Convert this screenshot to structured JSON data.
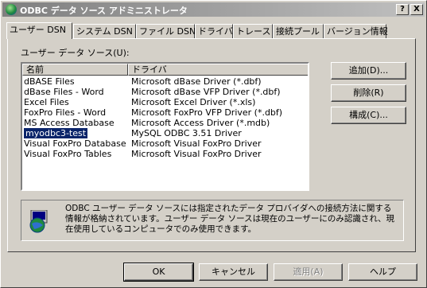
{
  "window": {
    "title": "ODBC データ ソース アドミニストレータ",
    "help_btn": "?",
    "close_btn": "X"
  },
  "tabs": [
    {
      "label": "ユーザー DSN",
      "active": true
    },
    {
      "label": "システム DSN"
    },
    {
      "label": "ファイル DSN"
    },
    {
      "label": "ドライバ"
    },
    {
      "label": "トレース"
    },
    {
      "label": "接続プール"
    },
    {
      "label": "バージョン情報"
    }
  ],
  "user_dsn": {
    "list_label": "ユーザー データ ソース(U):",
    "columns": [
      "名前",
      "ドライバ"
    ],
    "rows": [
      {
        "name": "dBASE Files",
        "driver": "Microsoft dBase Driver (*.dbf)"
      },
      {
        "name": "dBase Files - Word",
        "driver": "Microsoft dBase VFP Driver (*.dbf)"
      },
      {
        "name": "Excel Files",
        "driver": "Microsoft Excel Driver (*.xls)"
      },
      {
        "name": "FoxPro Files - Word",
        "driver": "Microsoft FoxPro VFP Driver (*.dbf)"
      },
      {
        "name": "MS Access Database",
        "driver": "Microsoft Access Driver (*.mdb)"
      },
      {
        "name": "myodbc3-test",
        "driver": "MySQL ODBC 3.51 Driver",
        "selected": true
      },
      {
        "name": "Visual FoxPro Database",
        "driver": "Microsoft Visual FoxPro Driver"
      },
      {
        "name": "Visual FoxPro Tables",
        "driver": "Microsoft Visual FoxPro Driver"
      }
    ],
    "add_btn": "追加(D)...",
    "remove_btn": "削除(R)",
    "config_btn": "構成(C)...",
    "info_text": "ODBC ユーザー データ ソースには指定されたデータ プロバイダへの接続方法に関する情報が格納されています。ユーザー データ ソースは現在のユーザーにのみ認識され、現在使用しているコンピュータでのみ使用できます。"
  },
  "footer": {
    "ok": "OK",
    "cancel": "キャンセル",
    "apply": "適用(A)",
    "help": "ヘルプ"
  }
}
